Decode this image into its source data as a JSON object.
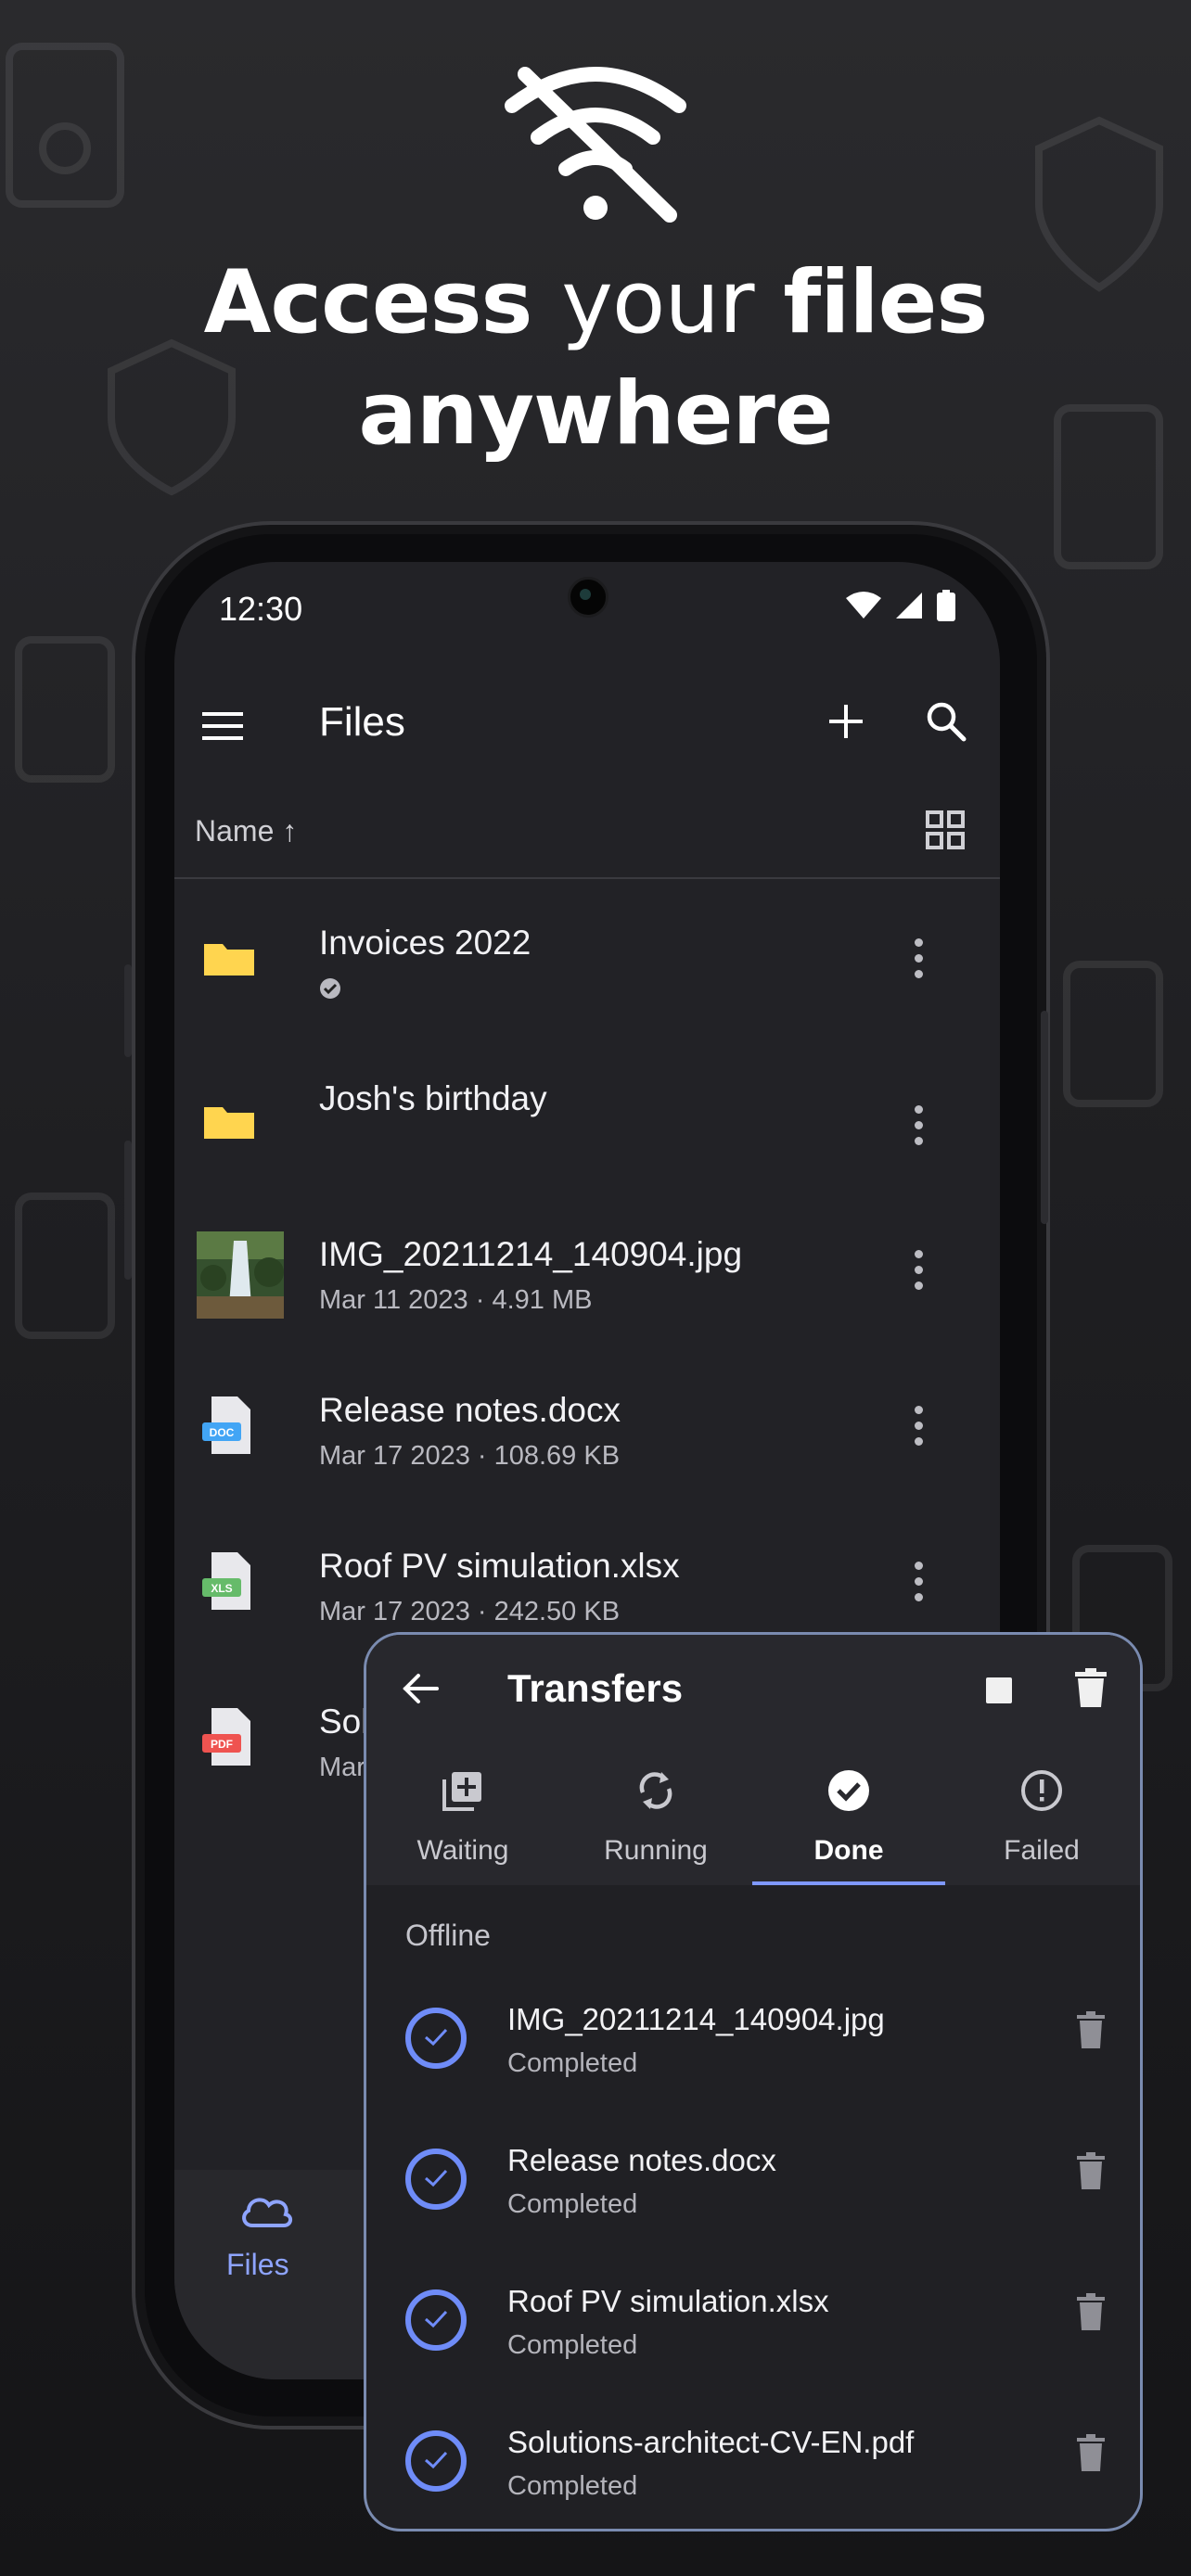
{
  "headline": {
    "line1_bold_a": "Access",
    "line1_thin": "your",
    "line1_bold_b": "files",
    "line2": "anywhere"
  },
  "status_bar": {
    "time": "12:30"
  },
  "app_bar": {
    "title": "Files"
  },
  "sort": {
    "label": "Name",
    "arrow": "↑"
  },
  "files": [
    {
      "name": "Invoices 2022",
      "meta": "",
      "icon": "folder-icon",
      "synced": true
    },
    {
      "name": "Josh's birthday",
      "meta": "",
      "icon": "folder-icon",
      "synced": false
    },
    {
      "name": "IMG_20211214_140904.jpg",
      "meta": "Mar 11 2023 · 4.91 MB",
      "icon": "image-thumbnail"
    },
    {
      "name": "Release notes.docx",
      "meta": "Mar 17 2023 · 108.69 KB",
      "icon": "doc-file-icon",
      "badge": "DOC"
    },
    {
      "name": "Roof PV simulation.xlsx",
      "meta": "Mar 17 2023 · 242.50 KB",
      "icon": "xls-file-icon",
      "badge": "XLS"
    },
    {
      "name": "Sol",
      "meta": "Mar",
      "icon": "pdf-file-icon",
      "badge": "PDF"
    }
  ],
  "bottom_nav": {
    "files_label": "Files"
  },
  "transfers": {
    "title": "Transfers",
    "tabs": [
      {
        "label": "Waiting"
      },
      {
        "label": "Running"
      },
      {
        "label": "Done"
      },
      {
        "label": "Failed"
      }
    ],
    "active_tab": "Done",
    "section": "Offline",
    "items": [
      {
        "name": "IMG_20211214_140904.jpg",
        "status": "Completed"
      },
      {
        "name": "Release notes.docx",
        "status": "Completed"
      },
      {
        "name": "Roof PV simulation.xlsx",
        "status": "Completed"
      },
      {
        "name": "Solutions-architect-CV-EN.pdf",
        "status": "Completed"
      }
    ]
  },
  "colors": {
    "accent": "#7f98ff",
    "folder": "#ffd54f",
    "doc_badge": "#42a5f5",
    "xls_badge": "#66bb6a",
    "pdf_badge": "#ef5350"
  }
}
